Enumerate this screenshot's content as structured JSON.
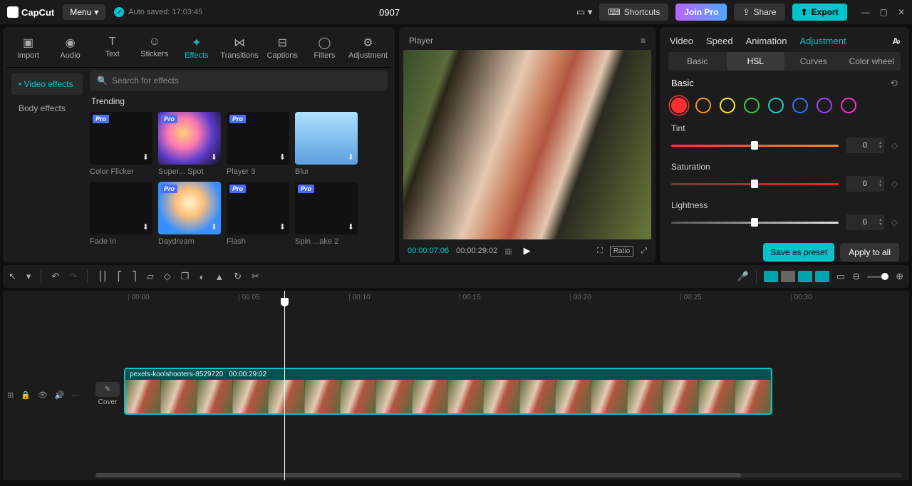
{
  "app": {
    "name": "CapCut",
    "menu": "Menu",
    "auto_saved": "Auto saved: 17:03:45",
    "project_title": "0907"
  },
  "titlebar": {
    "shortcuts": "Shortcuts",
    "join_pro": "Join Pro",
    "share": "Share",
    "export": "Export"
  },
  "media_tabs": [
    "Import",
    "Audio",
    "Text",
    "Stickers",
    "Effects",
    "Transitions",
    "Captions",
    "Filters",
    "Adjustment"
  ],
  "media_tab_active": 4,
  "left_side": {
    "items": [
      "Video effects",
      "Body effects"
    ],
    "active": 0
  },
  "search": {
    "placeholder": "Search for effects"
  },
  "section": "Trending",
  "effects_row1": [
    {
      "name": "Color Flicker",
      "pro": true,
      "style": ""
    },
    {
      "name": "Super... Spot",
      "pro": true,
      "style": "bright"
    },
    {
      "name": "Player 3",
      "pro": true,
      "style": ""
    },
    {
      "name": "Blur",
      "pro": false,
      "style": "sky"
    }
  ],
  "effects_row2": [
    {
      "name": "Fade In",
      "pro": false,
      "style": ""
    },
    {
      "name": "Daydream",
      "pro": true,
      "style": "glow"
    },
    {
      "name": "Flash",
      "pro": true,
      "style": ""
    },
    {
      "name": "Spin ...ake 2",
      "pro": true,
      "style": ""
    }
  ],
  "player": {
    "label": "Player",
    "current": "00:00:07:06",
    "total": "00:00:29:02",
    "ratio": "Ratio"
  },
  "right_tabs": [
    "Video",
    "Speed",
    "Animation",
    "Adjustment"
  ],
  "right_tab_active": 3,
  "sub_tabs": [
    "Basic",
    "HSL",
    "Curves",
    "Color wheel"
  ],
  "sub_tab_active": 1,
  "hsl": {
    "header": "Basic",
    "colors": [
      "#ff3030",
      "#ff9020",
      "#ffe030",
      "#30d050",
      "#20d0d0",
      "#3070ff",
      "#a040ff",
      "#ff30c0"
    ],
    "selected": 0,
    "tint": {
      "label": "Tint",
      "value": "0"
    },
    "saturation": {
      "label": "Saturation",
      "value": "0"
    },
    "lightness": {
      "label": "Lightness",
      "value": "0"
    }
  },
  "footer": {
    "preset": "Save as preset",
    "apply": "Apply to all"
  },
  "ruler": [
    "00:00",
    "00:05",
    "00:10",
    "00:15",
    "00:20",
    "00:25",
    "00:30"
  ],
  "clip": {
    "name": "pexels-koolshooters-8529720",
    "duration": "00:00:29:02"
  },
  "cover": "Cover"
}
